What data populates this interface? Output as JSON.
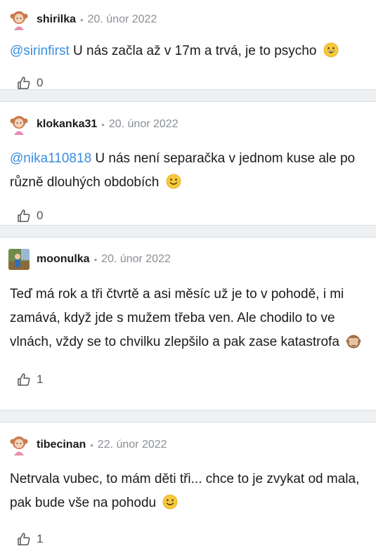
{
  "posts": [
    {
      "username": "shirilka",
      "date": "20. únor 2022",
      "mention": "@sirinfirst",
      "text": " U nás začla až v 17m a trvá, je to psycho",
      "likes": "0",
      "avatar": "girl-avatar-icon",
      "emoji": "grinning-face-icon"
    },
    {
      "username": "klokanka31",
      "date": "20. únor 2022",
      "mention": "@nika110818",
      "text": " U nás není separačka v jednom kuse ale po různě dlouhých obdobích",
      "likes": "0",
      "avatar": "girl-avatar-icon",
      "emoji": "slightly-smiling-face-icon"
    },
    {
      "username": "moonulka",
      "date": "20. únor 2022",
      "mention": "",
      "text": "Teď má rok a tři čtvrtě a asi měsíc už je to v pohodě, i mi zamává, když jde s mužem třeba ven. Ale chodilo to ve vlnách, vždy se to chvilku zlepšilo a pak zase katastrofa",
      "likes": "1",
      "avatar": "photo-avatar",
      "emoji": "see-no-evil-monkey-icon"
    },
    {
      "username": "tibecinan",
      "date": "22. únor 2022",
      "mention": "",
      "text": "Netrvala vubec, to mám děti tři... chce to je zvykat od mala, pak bude vše na pohodu",
      "likes": "1",
      "avatar": "girl-avatar-icon",
      "emoji": "slightly-smiling-face-icon"
    }
  ],
  "colors": {
    "mention": "#3a8de0",
    "separator": "#eef0f2",
    "date": "#8a8f95"
  }
}
